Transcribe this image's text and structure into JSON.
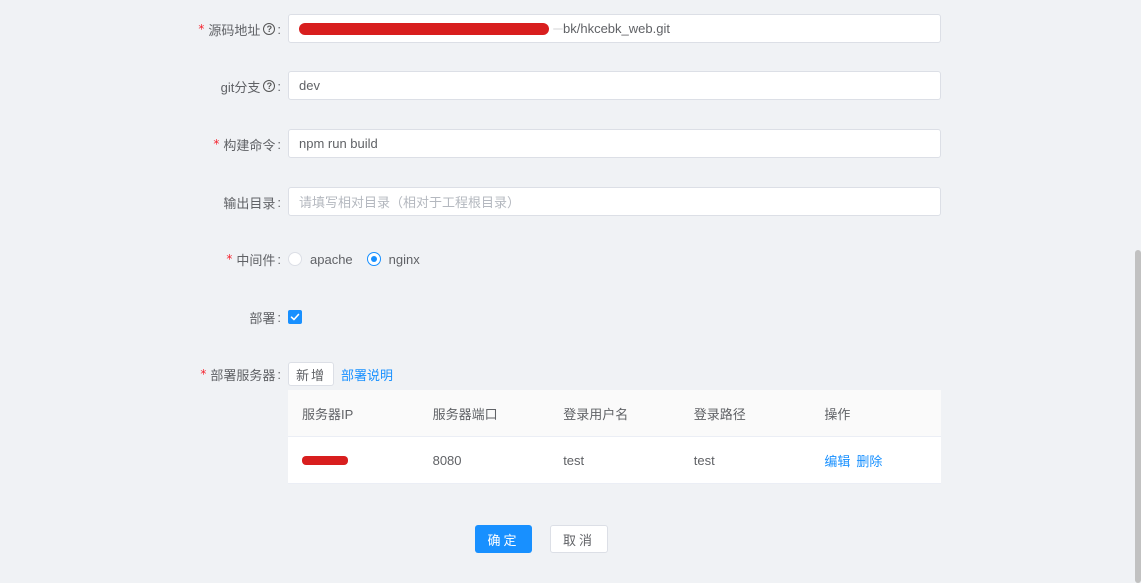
{
  "form": {
    "source_url": {
      "label": "源码地址",
      "value_suffix": "bk/hkcebk_web.git",
      "required": true
    },
    "git_branch": {
      "label": "git分支",
      "value": "dev"
    },
    "build_cmd": {
      "label": "构建命令",
      "value": "npm run build",
      "required": true
    },
    "output_dir": {
      "label": "输出目录",
      "placeholder": "请填写相对目录（相对于工程根目录）"
    },
    "middleware": {
      "label": "中间件",
      "options": [
        "apache",
        "nginx"
      ],
      "selected": "nginx",
      "required": true
    },
    "deploy": {
      "label": "部署",
      "checked": true
    },
    "deploy_servers": {
      "label": "部署服务器",
      "add_label": "新增",
      "doc_link": "部署说明",
      "required": true
    }
  },
  "table": {
    "headers": [
      "服务器IP",
      "服务器端口",
      "登录用户名",
      "登录路径",
      "操作"
    ],
    "rows": [
      {
        "ip": "",
        "port": "8080",
        "user": "test",
        "path": "test",
        "edit": "编辑",
        "delete": "删除"
      }
    ]
  },
  "footer": {
    "ok": "确定",
    "cancel": "取消"
  },
  "colors": {
    "primary": "#1890ff",
    "required": "#f5222d",
    "redaction": "#d81e1e"
  }
}
